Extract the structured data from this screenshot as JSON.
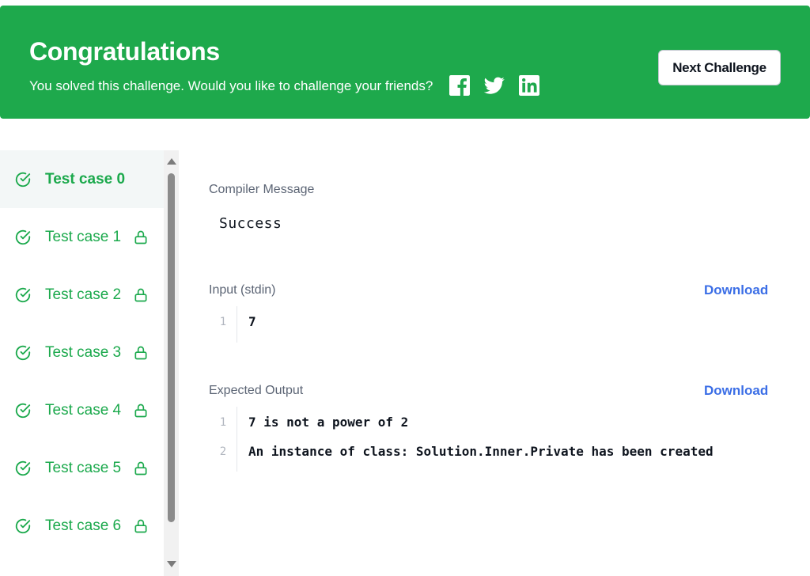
{
  "banner": {
    "title": "Congratulations",
    "subtitle": "You solved this challenge. Would you like to challenge your friends?",
    "share_icons": [
      "facebook-icon",
      "twitter-icon",
      "linkedin-icon"
    ],
    "next_button_label": "Next Challenge",
    "color": "#1ea94c"
  },
  "sidebar": {
    "active_index": 0,
    "items": [
      {
        "label": "Test case 0",
        "status": "passed",
        "locked": false
      },
      {
        "label": "Test case 1",
        "status": "passed",
        "locked": true
      },
      {
        "label": "Test case 2",
        "status": "passed",
        "locked": true
      },
      {
        "label": "Test case 3",
        "status": "passed",
        "locked": true
      },
      {
        "label": "Test case 4",
        "status": "passed",
        "locked": true
      },
      {
        "label": "Test case 5",
        "status": "passed",
        "locked": true
      },
      {
        "label": "Test case 6",
        "status": "passed",
        "locked": true
      }
    ],
    "accent_color": "#1ba94c"
  },
  "compiler": {
    "title": "Compiler Message",
    "message": "Success"
  },
  "input": {
    "title": "Input (stdin)",
    "download_label": "Download",
    "lines": [
      {
        "num": "1",
        "text": "7"
      }
    ]
  },
  "expected": {
    "title": "Expected Output",
    "download_label": "Download",
    "lines": [
      {
        "num": "1",
        "text": "7 is not a power of 2"
      },
      {
        "num": "2",
        "text": "An instance of class: Solution.Inner.Private has been created"
      }
    ]
  },
  "link_color": "#3b6ee6"
}
